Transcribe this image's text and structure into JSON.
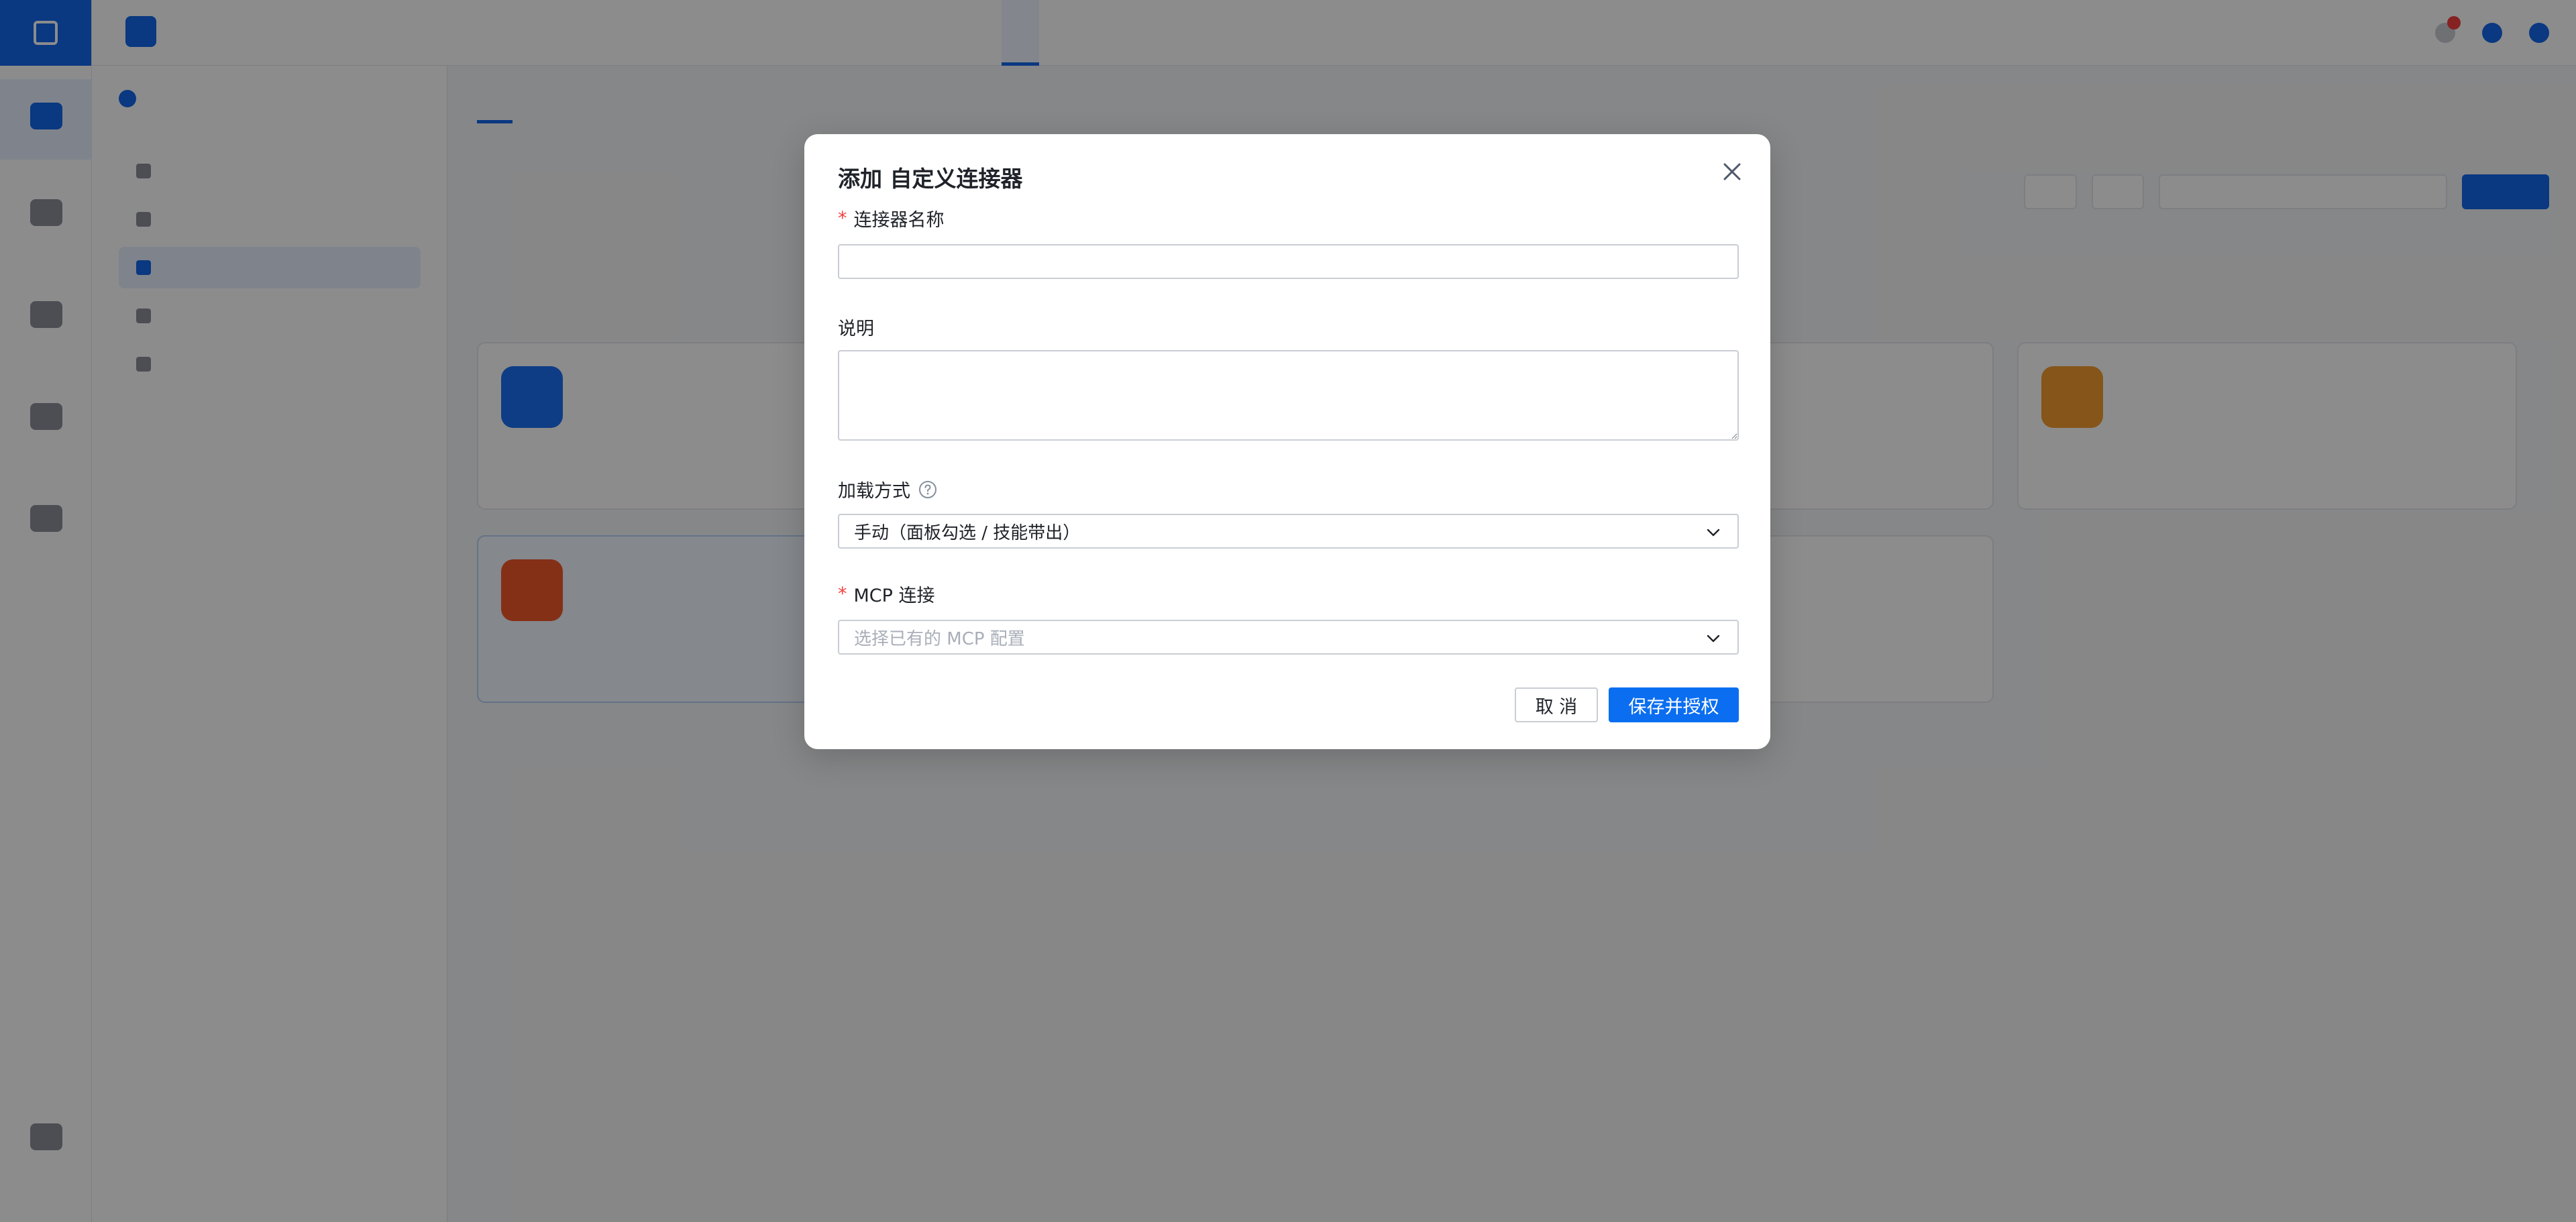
{
  "modal": {
    "title": "添加 自定义连接器",
    "fields": {
      "name": {
        "label": "连接器名称",
        "required": true,
        "value": "",
        "placeholder": ""
      },
      "description": {
        "label": "说明",
        "value": "",
        "placeholder": ""
      },
      "load_mode": {
        "label": "加载方式",
        "value": "手动（面板勾选 / 技能带出）"
      },
      "mcp": {
        "label": "MCP 连接",
        "required": true,
        "placeholder": "选择已有的 MCP 配置"
      }
    },
    "buttons": {
      "cancel": "取 消",
      "ok": "保存并授权"
    }
  },
  "colors": {
    "primary": "#0b6ef0",
    "required": "#f53f3f",
    "overlay": "rgba(0,0,0,0.45)"
  },
  "icons": [
    "close-icon",
    "help-circle-icon",
    "chevron-down-icon"
  ]
}
